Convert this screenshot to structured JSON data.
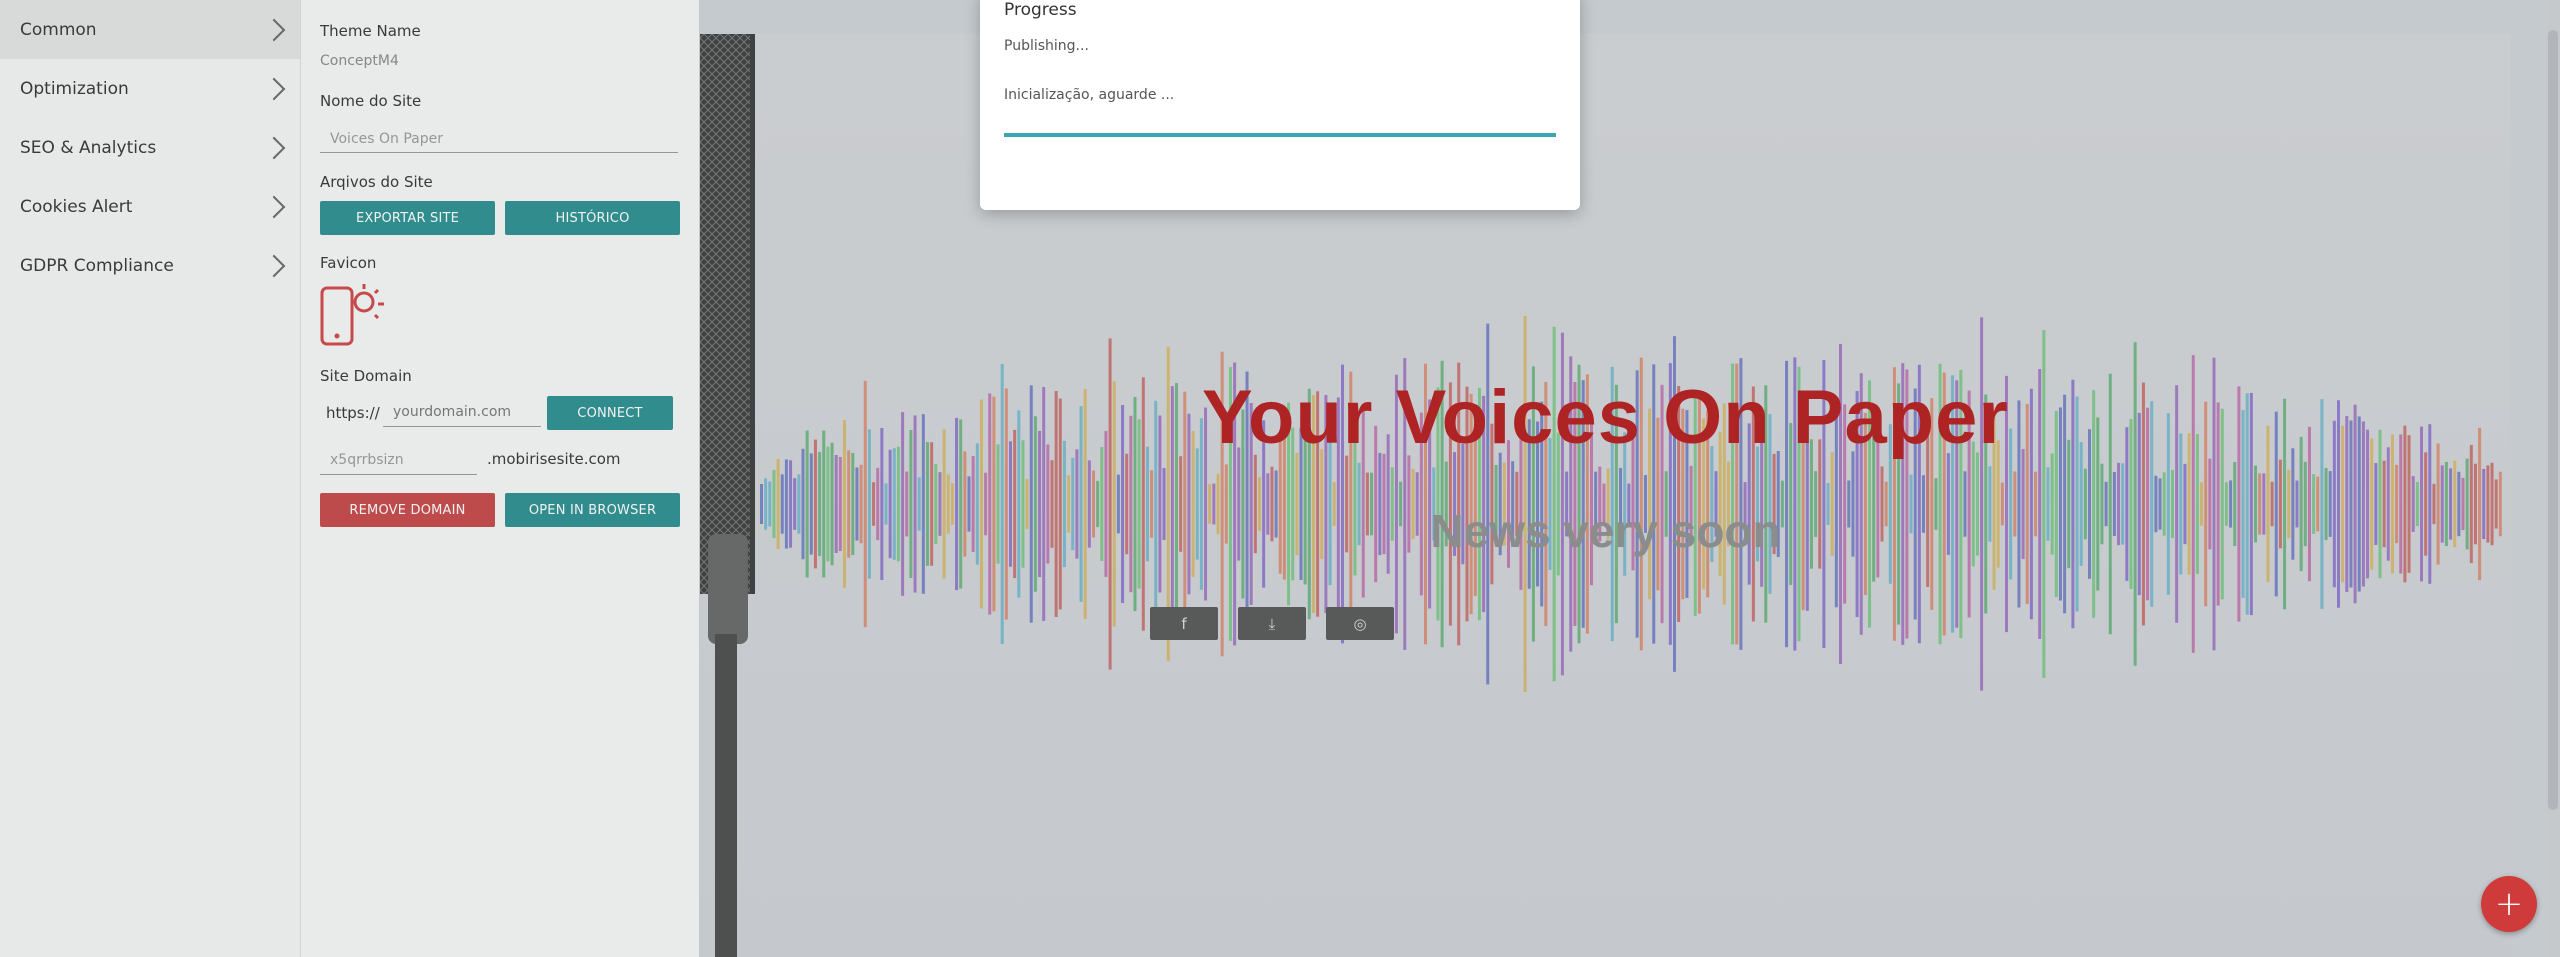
{
  "sidebar": {
    "items": [
      {
        "label": "Common",
        "active": true
      },
      {
        "label": "Optimization",
        "active": false
      },
      {
        "label": "SEO & Analytics",
        "active": false
      },
      {
        "label": "Cookies Alert",
        "active": false
      },
      {
        "label": "GDPR Compliance",
        "active": false
      }
    ]
  },
  "settings": {
    "theme_name_label": "Theme Name",
    "theme_name_value": "ConceptM4",
    "site_name_label": "Nome do Site",
    "site_name_value": "Voices On Paper",
    "site_files_label": "Arqivos do Site",
    "export_button": "EXPORTAR SITE",
    "history_button": "HISTÓRICO",
    "favicon_label": "Favicon",
    "domain_label": "Site Domain",
    "protocol": "https://",
    "domain_placeholder": "yourdomain.com",
    "connect_button": "CONNECT",
    "subdomain_value": "x5qrrbsizn",
    "subdomain_suffix": ".mobirisesite.com",
    "remove_domain_button": "REMOVE DOMAIN",
    "open_browser_button": "OPEN IN BROWSER"
  },
  "modal": {
    "title": "Progress",
    "status": "Publishing...",
    "detail": "Inicialização, aguarde ...",
    "progress_percent": 100
  },
  "preview": {
    "title": "Your Voices On Paper",
    "subtitle": "News very soon",
    "social": [
      {
        "icon": "facebook-icon",
        "glyph": "f"
      },
      {
        "icon": "download-icon",
        "glyph": "⤓"
      },
      {
        "icon": "instagram-icon",
        "glyph": "◎"
      }
    ]
  },
  "fab": {
    "glyph": "+"
  },
  "colors": {
    "accent_teal": "#2a8f8f",
    "danger_red": "#c64646",
    "hero_title": "#b51a1a"
  }
}
